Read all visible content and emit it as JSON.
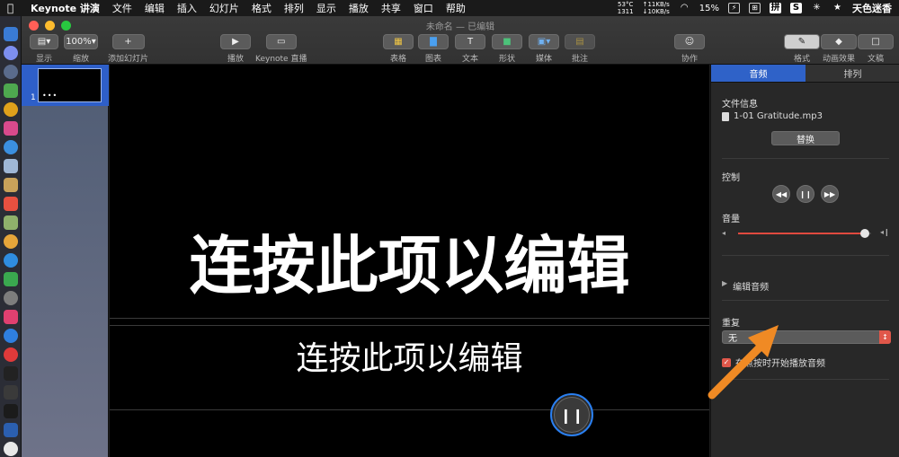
{
  "menubar": {
    "app_name": "Keynote 讲演",
    "items": [
      "文件",
      "编辑",
      "插入",
      "幻灯片",
      "格式",
      "排列",
      "显示",
      "播放",
      "共享",
      "窗口",
      "帮助"
    ],
    "temp": "53°C",
    "rpm": "1311",
    "net_up": "↑11KB/s",
    "net_down": "↓10KB/s",
    "battery": "15%",
    "ime": "拼",
    "ime2": "S",
    "user": "天色迷香"
  },
  "window": {
    "title": "未命名 — 已编辑"
  },
  "toolbar": {
    "view_label": "显示",
    "zoom_value": "100%",
    "zoom_label": "缩放",
    "add_slide_label": "添加幻灯片",
    "play_label": "播放",
    "keynote_live_label": "Keynote 直播",
    "table_label": "表格",
    "chart_label": "图表",
    "text_label": "文本",
    "shape_label": "形状",
    "media_label": "媒体",
    "comment_label": "批注",
    "collaborate_label": "协作",
    "format_label": "格式",
    "animate_label": "动画效果",
    "document_label": "文稿"
  },
  "navigator": {
    "slide_number": "1",
    "thumb_dots": "•••"
  },
  "slide": {
    "title": "连按此项以编辑",
    "subtitle": "连按此项以编辑"
  },
  "inspector": {
    "tab_audio": "音频",
    "tab_arrange": "排列",
    "file_info_label": "文件信息",
    "file_name": "1-01 Gratitude.mp3",
    "replace_label": "替换",
    "controls_label": "控制",
    "volume_label": "音量",
    "volume_level": 0.95,
    "edit_audio_label": "编辑音频",
    "repeat_label": "重复",
    "repeat_value": "无",
    "autoplay_label": "在点按时开始播放音频"
  },
  "colors": {
    "accent_blue": "#2f62c8",
    "accent_red": "#e0574a",
    "annotation_orange": "#f08a24"
  }
}
